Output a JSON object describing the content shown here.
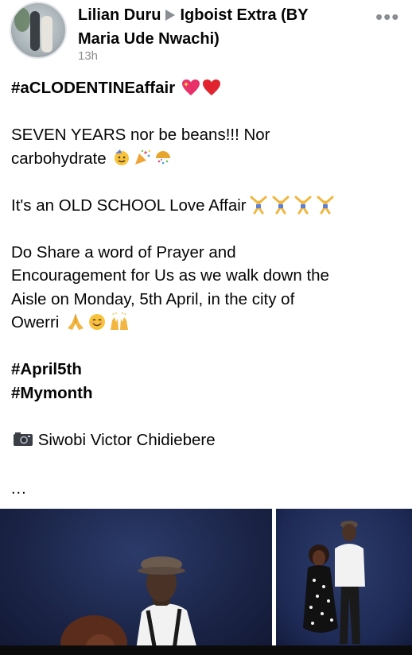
{
  "post": {
    "author": "Lilian Duru",
    "target": "Igboist Extra (BY",
    "target_cont": "Maria Ude Nwachi)",
    "time": "13h",
    "more_label": "•••",
    "hashtag_title": "#aCLODENTINEaffair",
    "line1": "SEVEN YEARS nor be beans!!! Nor",
    "line2": "carbohydrate",
    "line3": "It's an OLD SCHOOL Love Affair",
    "line4": "Do Share a word of Prayer and",
    "line5": "Encouragement for Us as we walk down the",
    "line6": "Aisle on Monday, 5th April, in the city of",
    "line7": "Owerri",
    "tag1": "#April5th",
    "tag2": "#Mymonth",
    "credit": "Siwobi Victor Chidiebere",
    "see_more": "..."
  },
  "colors": {
    "name_text": "#050505",
    "meta_gray": "#8a8d91",
    "heart_red": "#e0242f",
    "photo_bg": "#1b2447"
  },
  "icons": [
    "avatar",
    "sparkling-heart-icon",
    "red-heart-icon",
    "party-face-icon",
    "party-popper-icon",
    "confetti-ball-icon",
    "cartwheel-icon",
    "folded-hands-icon",
    "smiling-face-icon",
    "raised-hands-icon",
    "camera-icon",
    "more-options-icon"
  ]
}
